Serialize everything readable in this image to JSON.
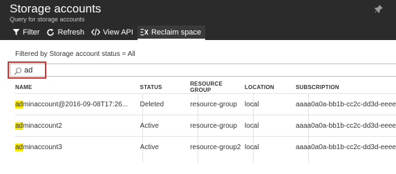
{
  "header": {
    "title": "Storage accounts",
    "subtitle": "Query for storage accounts"
  },
  "toolbar": {
    "filter": "Filter",
    "refresh": "Refresh",
    "view_api": "View API",
    "reclaim": "Reclaim space"
  },
  "filter_note": "Filtered by Storage account status = All",
  "search": {
    "value": "ad"
  },
  "table": {
    "columns": [
      "NAME",
      "STATUS",
      "RESOURCE GROUP",
      "LOCATION",
      "SUBSCRIPTION"
    ],
    "rows": [
      {
        "name_match": "ad",
        "name_rest": "minaccount@2016-09-08T17:26...",
        "status": "Deleted",
        "group": "resource-group",
        "location": "local",
        "subscription": "aaaa0a0a-bb1b-cc2c-dd3d-eeee"
      },
      {
        "name_match": "ad",
        "name_rest": "minaccount2",
        "status": "Active",
        "group": "resource-group",
        "location": "local",
        "subscription": "aaaa0a0a-bb1b-cc2c-dd3d-eeee"
      },
      {
        "name_match": "ad",
        "name_rest": "minaccount3",
        "status": "Active",
        "group": "resource-group2",
        "location": "local",
        "subscription": "aaaa0a0a-bb1b-cc2c-dd3d-eeee"
      }
    ]
  },
  "colors": {
    "header_bg": "#2b2b2b",
    "highlight": "#f6e600",
    "callout": "#d0312d"
  }
}
